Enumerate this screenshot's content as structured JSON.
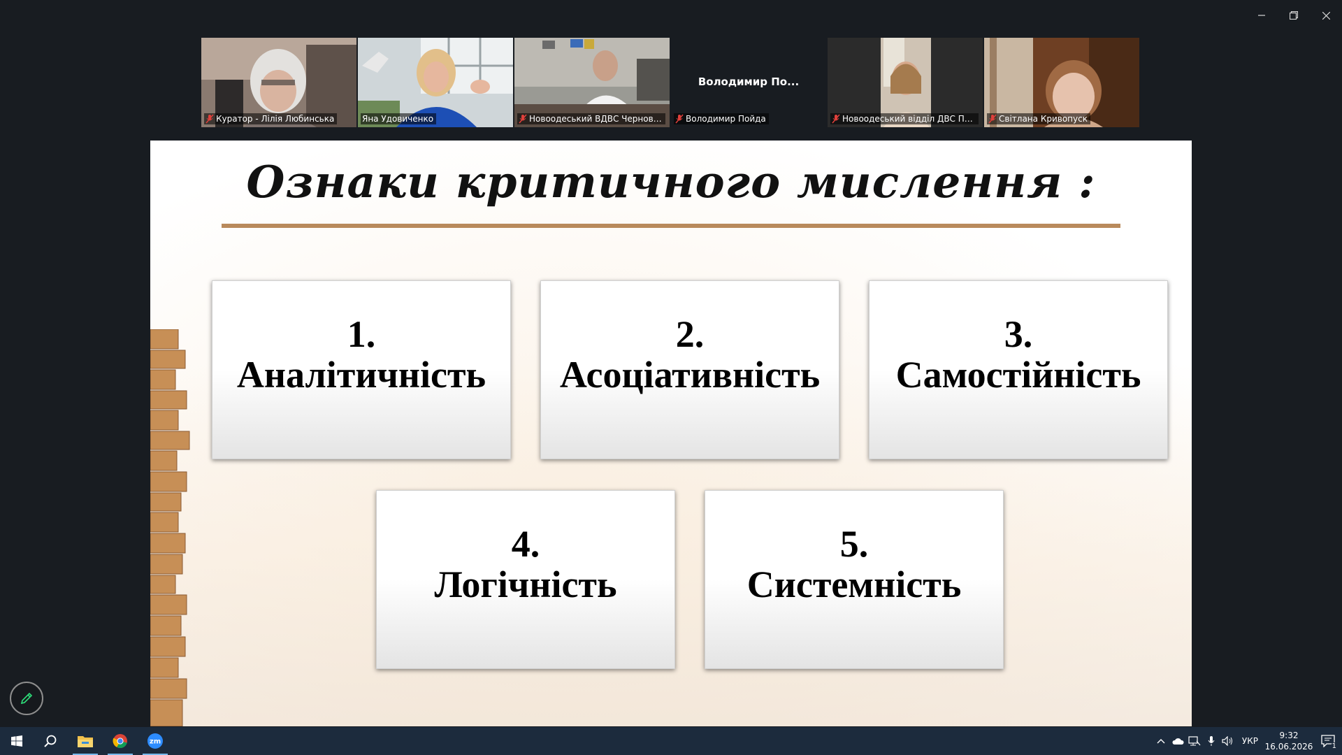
{
  "window": {
    "controls": [
      "minimize",
      "restore",
      "close"
    ]
  },
  "participants": [
    {
      "name": "Куратор - Лілія Любинська",
      "muted": true,
      "active": false,
      "video": true
    },
    {
      "name": "Яна Удовиченко",
      "muted": false,
      "active": true,
      "video": true
    },
    {
      "name": "Новоодеський ВДВС Чернова І...",
      "muted": true,
      "active": false,
      "video": true
    },
    {
      "name": "Володимир Пойда",
      "display_name": "Володимир  По...",
      "muted": true,
      "active": false,
      "video": false
    },
    {
      "name": "Новоодеський відділ ДВС Прит...",
      "muted": true,
      "active": false,
      "video": true
    },
    {
      "name": "Світлана Кривопуск",
      "muted": true,
      "active": false,
      "video": true
    }
  ],
  "slide": {
    "title": "Ознаки критичного мислення :",
    "rule_color": "#b98a5c",
    "items": [
      {
        "number": "1.",
        "label": "Аналітичність"
      },
      {
        "number": "2.",
        "label": "Асоціативність"
      },
      {
        "number": "3.",
        "label": "Самостійність"
      },
      {
        "number": "4.",
        "label": "Логічність"
      },
      {
        "number": "5.",
        "label": "Системність"
      }
    ]
  },
  "annotate_button": {
    "icon": "pencil-icon",
    "color": "#2ee07a"
  },
  "taskbar": {
    "apps": [
      "windows-start-icon",
      "search-icon",
      "file-explorer-icon",
      "chrome-icon",
      "zoom-icon"
    ],
    "tray": {
      "language": "УКР",
      "time": "9:32",
      "date": "16.06.2026",
      "notification_count": "1"
    }
  }
}
